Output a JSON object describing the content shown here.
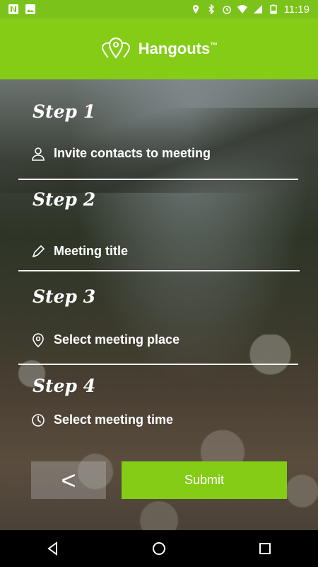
{
  "status_bar": {
    "time": "11:19",
    "left_icons": [
      "n-notification-icon",
      "image-icon"
    ],
    "right_icons": [
      "location-icon",
      "bluetooth-icon",
      "alarm-icon",
      "wifi-icon",
      "signal-icon",
      "battery-icon"
    ]
  },
  "header": {
    "logo_icon": "location-pins-icon",
    "title": "Hangouts",
    "trademark": "™"
  },
  "steps": [
    {
      "title": "Step 1",
      "label": "Invite contacts to meeting",
      "icon": "person-icon"
    },
    {
      "title": "Step 2",
      "label": "Meeting title",
      "icon": "pencil-icon"
    },
    {
      "title": "Step 3",
      "label": "Select meeting place",
      "icon": "location-pin-icon"
    },
    {
      "title": "Step 4",
      "label": "Select meeting time",
      "icon": "clock-icon"
    }
  ],
  "buttons": {
    "back_label": "<",
    "submit_label": "Submit"
  },
  "colors": {
    "accent": "#84cc16",
    "status_bar": "#7bc31a"
  },
  "nav_bar": {
    "icons": [
      "back-triangle-icon",
      "home-circle-icon",
      "recents-square-icon"
    ]
  }
}
